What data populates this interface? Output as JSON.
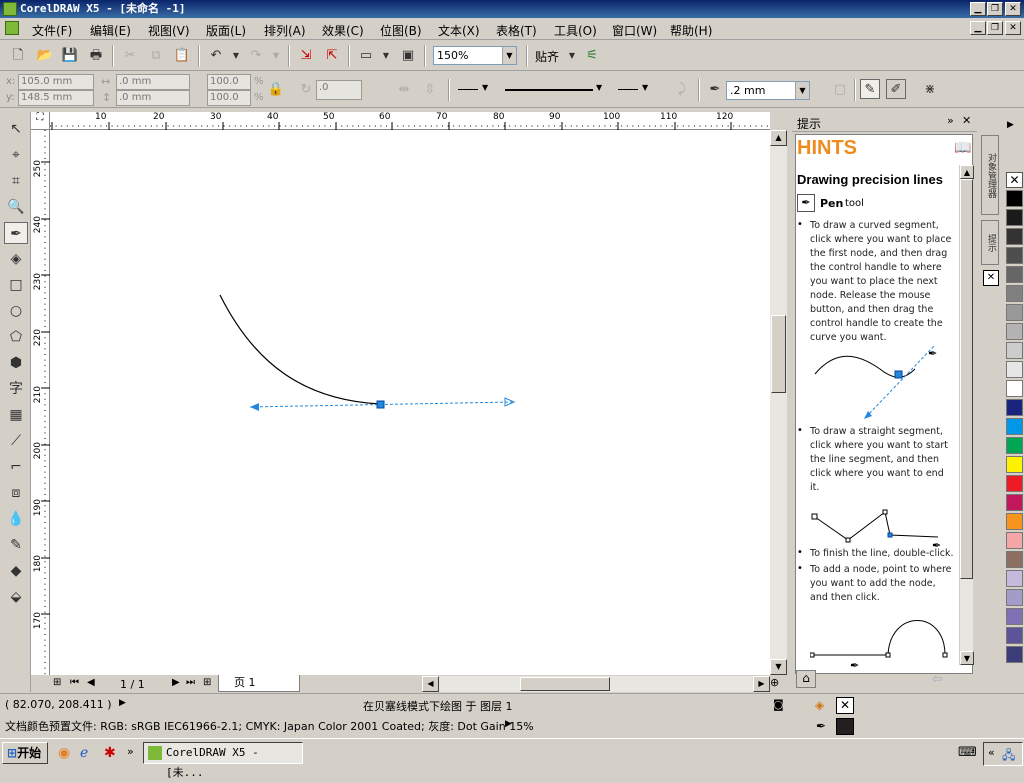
{
  "title": "CorelDRAW X5 - [未命名 -1]",
  "menu": [
    "文件(F)",
    "编辑(E)",
    "视图(V)",
    "版面(L)",
    "排列(A)",
    "效果(C)",
    "位图(B)",
    "文本(X)",
    "表格(T)",
    "工具(O)",
    "窗口(W)",
    "帮助(H)"
  ],
  "toolbar": {
    "zoom": "150%",
    "snap": "贴齐"
  },
  "props": {
    "x_label": "x:",
    "x": "105.0 mm",
    "y_label": "y:",
    "y": "148.5 mm",
    "w": ".0 mm",
    "h": ".0 mm",
    "sx": "100.0",
    "sy": "100.0",
    "pct1": "%",
    "pct2": "%",
    "angle": ".0",
    "outline_width": ".2 mm"
  },
  "ruler_h": [
    "10",
    "20",
    "30",
    "40",
    "50",
    "60",
    "70",
    "80",
    "90",
    "100",
    "110",
    "120"
  ],
  "ruler_v": [
    "250",
    "240",
    "230",
    "220",
    "210",
    "200",
    "190",
    "180",
    "170"
  ],
  "page_nav": {
    "count": "1 / 1",
    "tab": "页 1"
  },
  "docker": {
    "title": "提示",
    "hints_header": "HINTS",
    "heading": "Drawing precision lines",
    "tool": "Pen",
    "tool_suffix": "tool",
    "p1": "To draw a curved segment, click where you want to place the first node, and then drag the control handle to where you want to place the next node. Release the mouse button, and then drag the control handle to create the curve you want.",
    "p2": "To draw a straight segment, click where you want to start the line segment, and then click where you want to end it.",
    "p3": "To finish the line, double-click.",
    "p4": "To add a node, point to where you want to add the node, and then click.",
    "tab1": "对象管理器",
    "tab2": "提示"
  },
  "status": {
    "coords": "( 82.070, 208.411 )",
    "message": "在贝塞线模式下绘图 于 图层 1",
    "profile": "文档颜色预置文件: RGB: sRGB IEC61966-2.1; CMYK: Japan Color 2001 Coated; 灰度: Dot Gain 15%"
  },
  "taskbar": {
    "start": "开始",
    "task": "CorelDRAW X5 - [未..."
  },
  "palette": [
    "#000000",
    "#1a1a1a",
    "#333333",
    "#4d4d4d",
    "#666666",
    "#808080",
    "#999999",
    "#b3b3b3",
    "#cccccc",
    "#e6e6e6",
    "#ffffff",
    "#1a237e",
    "#0097e6",
    "#00a651",
    "#fff200",
    "#ed1c24",
    "#c2185b",
    "#f7941d",
    "#f4a6a6",
    "#8d6e63",
    "#c5b9dc",
    "#a39cc9",
    "#7e72b4",
    "#5c5499",
    "#3c3c78"
  ]
}
